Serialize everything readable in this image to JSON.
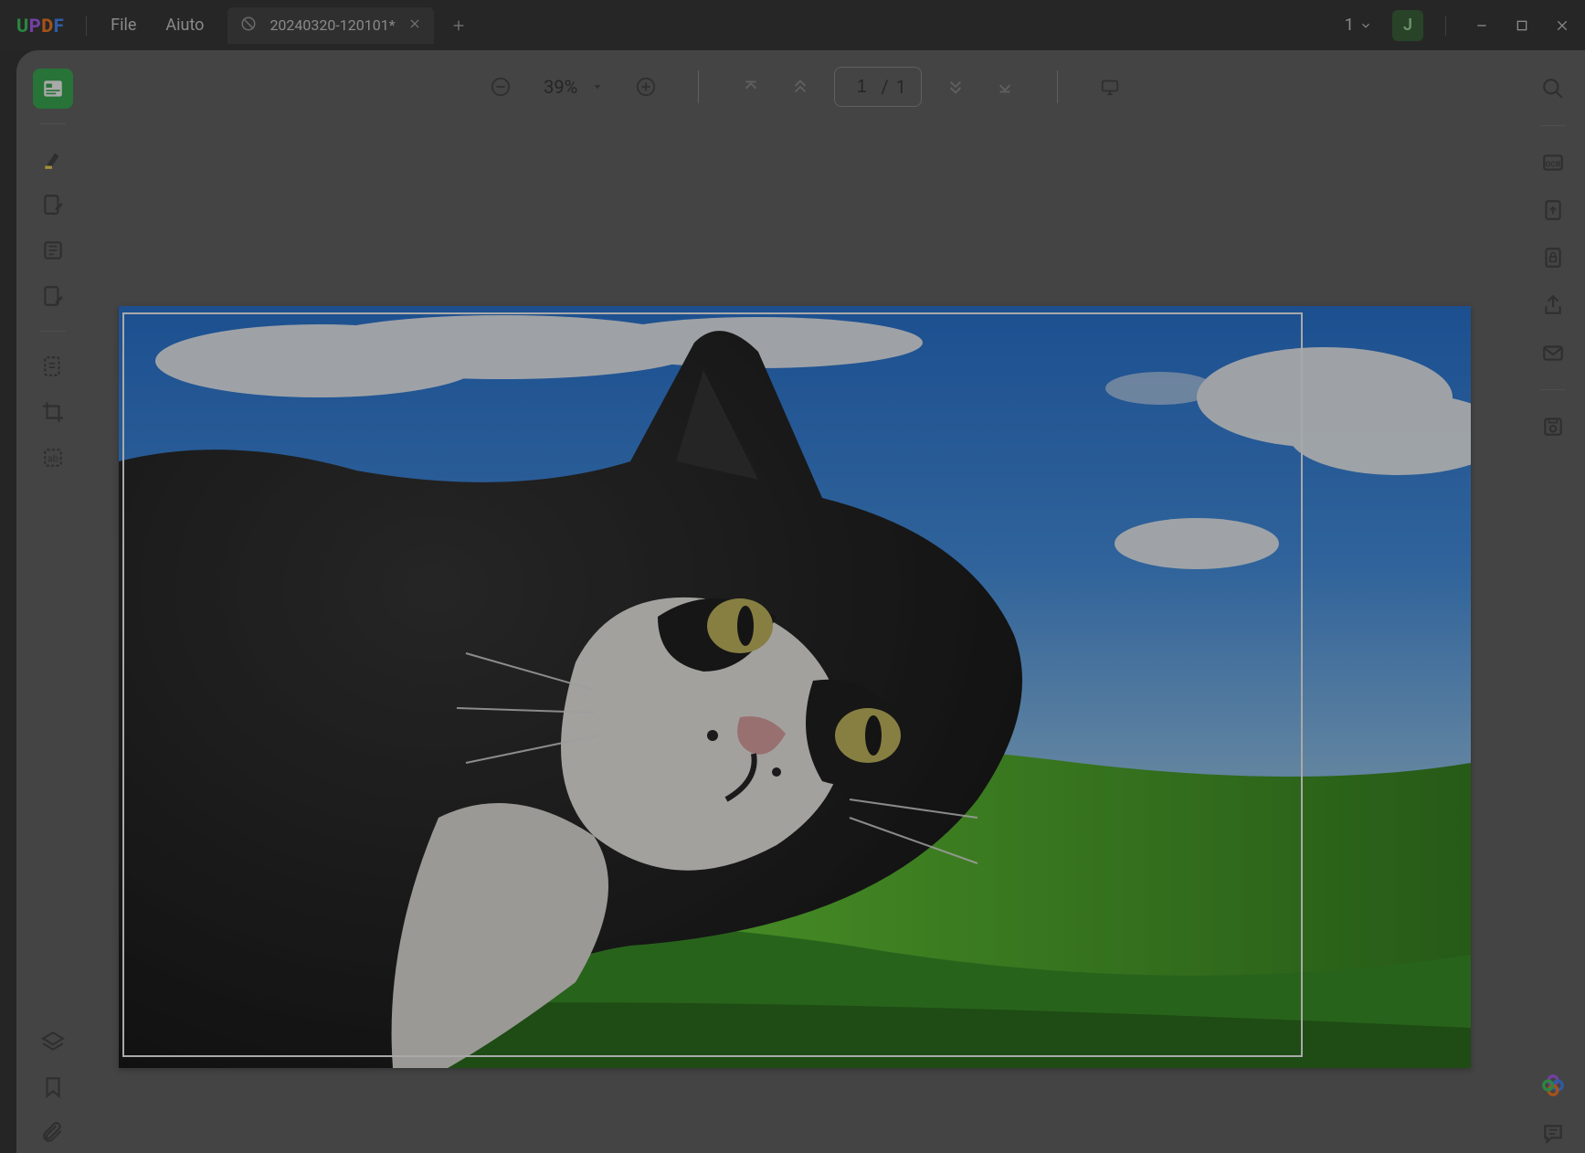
{
  "app": {
    "name": "UPDF"
  },
  "menu": {
    "file": "File",
    "help": "Aiuto"
  },
  "tab": {
    "title": "20240320-120101*"
  },
  "titlebar": {
    "window_count": "1",
    "avatar_initial": "J"
  },
  "toolbar": {
    "zoom": "39%",
    "page_current": "1",
    "page_separator": "/",
    "page_total": "1"
  },
  "left_tools": [
    {
      "name": "reader-tool",
      "active": true
    },
    {
      "name": "highlight-tool",
      "active": false
    },
    {
      "name": "edit-tool",
      "active": false
    },
    {
      "name": "page-tool",
      "active": false
    },
    {
      "name": "comment-tool",
      "active": false
    }
  ],
  "doc": {
    "image_alt": "Black and white cat in front of green hill and blue sky (Bliss wallpaper style)"
  }
}
